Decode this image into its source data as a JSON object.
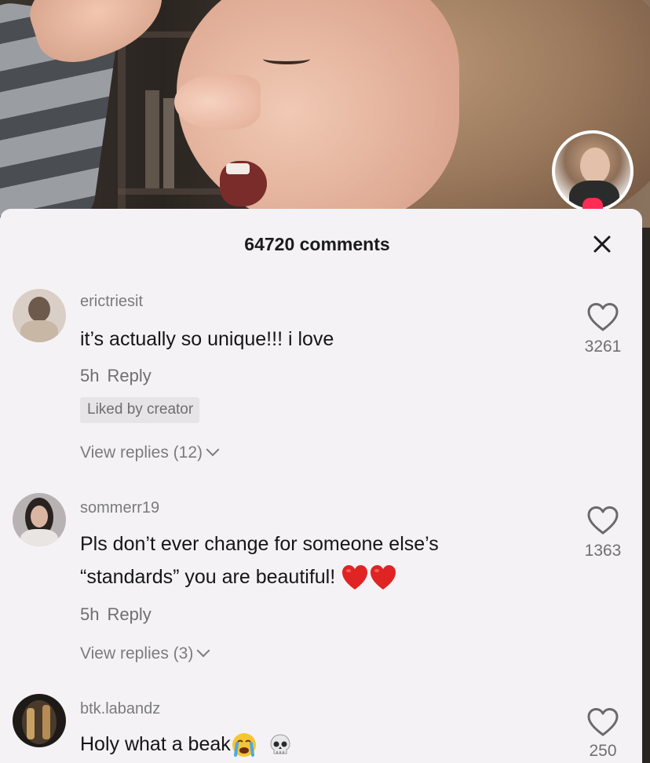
{
  "sheet": {
    "title": "64720 comments"
  },
  "comments": [
    {
      "username": "erictriesit",
      "text": "it’s actually so unique!!! i love",
      "time": "5h",
      "reply_label": "Reply",
      "liked_by_creator": "Liked by creator",
      "view_replies": "View replies (12)",
      "likes": "3261"
    },
    {
      "username": "sommerr19",
      "text_line1": "Pls don’t ever change for someone else’s",
      "text_line2": "“standards” you are beautiful!",
      "text_emoji": "red-heart-emoji x2",
      "time": "5h",
      "reply_label": "Reply",
      "view_replies": "View replies (3)",
      "likes": "1363"
    },
    {
      "username": "btk.labandz",
      "text": "Holy what a beak",
      "text_emoji": "crying-face-emoji, skull-emoji",
      "likes": "250"
    }
  ],
  "icons": {
    "close": "close-icon",
    "like": "heart-outline-icon",
    "follow": "follow-plus-badge"
  },
  "colors": {
    "sheet_bg": "#f4f2f4",
    "follow_accent": "#fe2c55",
    "heart_emoji": "#e02424"
  }
}
